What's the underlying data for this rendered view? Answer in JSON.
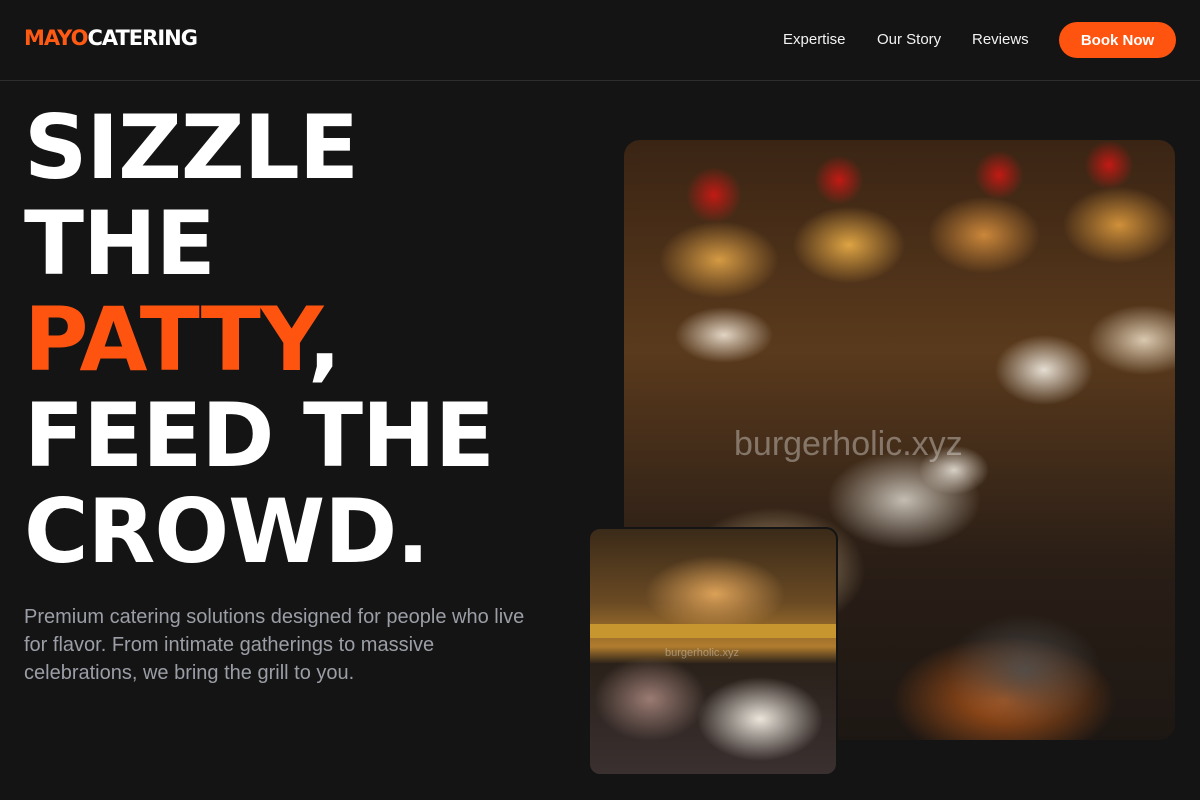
{
  "brand": {
    "accent_text": "MAYO",
    "rest_text": "CATERING",
    "accent_color": "#ff5410"
  },
  "nav": {
    "items": [
      {
        "label": "Expertise"
      },
      {
        "label": "Our Story"
      },
      {
        "label": "Reviews"
      }
    ],
    "cta_label": "Book Now"
  },
  "hero": {
    "title_line_1": "SIZZLE",
    "title_line_2": "THE",
    "title_highlight": "PATTY",
    "title_comma": ",",
    "title_line_4": "FEED THE",
    "title_line_5": "CROWD.",
    "subtitle": "Premium catering solutions designed for people who live for flavor. From intimate gatherings to massive celebrations, we bring the grill to you."
  },
  "images": {
    "main_watermark": "burgerholic.xyz",
    "small_watermark": "burgerholic.xyz"
  }
}
